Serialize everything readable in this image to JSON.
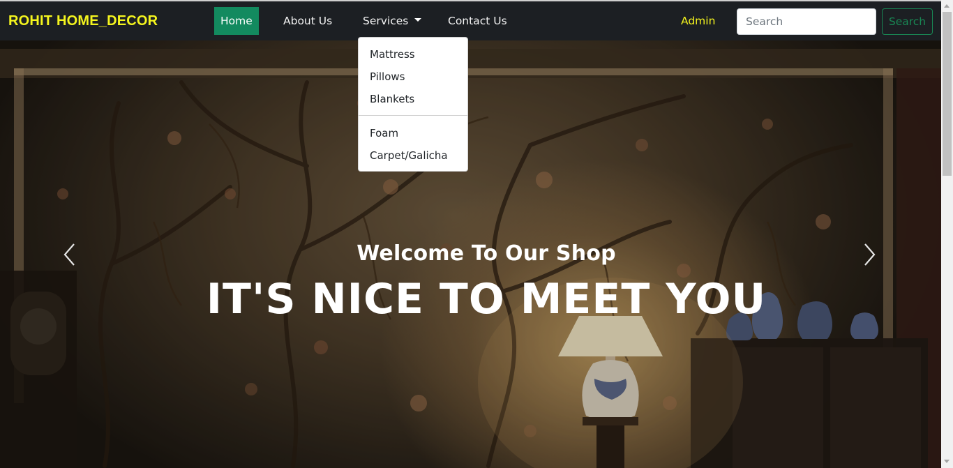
{
  "navbar": {
    "brand": "ROHIT HOME_DECOR",
    "items": [
      {
        "label": "Home",
        "active": true
      },
      {
        "label": "About Us"
      },
      {
        "label": "Services",
        "dropdown": true
      },
      {
        "label": "Contact Us"
      }
    ],
    "admin_label": "Admin",
    "search_placeholder": "Search",
    "search_button": "Search"
  },
  "dropdown": {
    "items": [
      "Mattress",
      "Pillows",
      "Blankets"
    ],
    "items_after_divider": [
      "Foam",
      "Carpet/Galicha"
    ]
  },
  "hero": {
    "subtitle": "Welcome To Our Shop",
    "title": "IT'S NICE TO MEET YOU"
  },
  "colors": {
    "brand": "#f5f51e",
    "active_nav": "#138a5f",
    "navbar_bg": "#1c1f23",
    "search_button": "#198754"
  },
  "icons": [
    "chevron-left-icon",
    "chevron-right-icon",
    "caret-down-icon"
  ]
}
